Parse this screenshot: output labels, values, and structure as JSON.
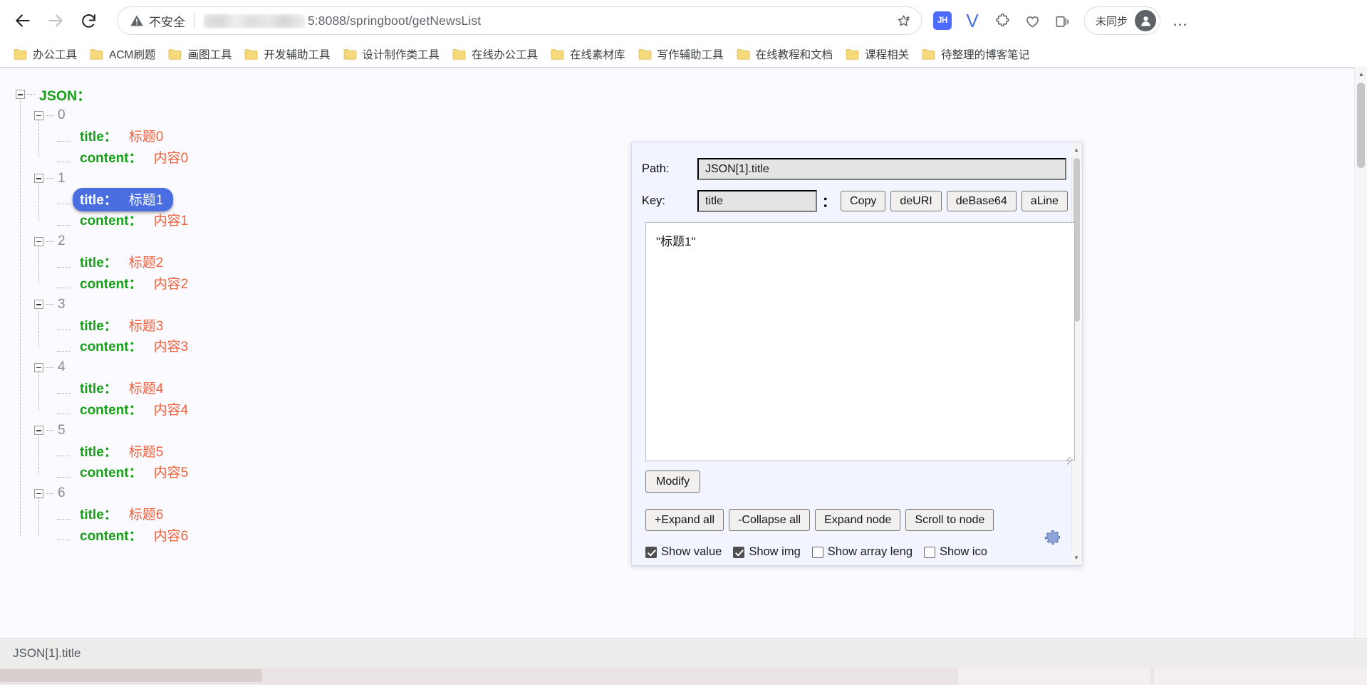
{
  "browser": {
    "nav": {
      "back": "back-arrow",
      "forward": "forward-arrow",
      "reload": "reload"
    },
    "omnibox": {
      "security_label": "不安全",
      "url_visible": "5:8088/springboot/getNewsList",
      "bookmark_icon": "star-plus-icon"
    },
    "extensions": [
      {
        "name": "jh-extension",
        "label": "JH"
      },
      {
        "name": "v-extension",
        "label": "V"
      }
    ],
    "profile": {
      "label": "未同步",
      "avatar": "person-icon"
    },
    "menu_label": "…",
    "bookmarks": [
      "办公工具",
      "ACM刷题",
      "画图工具",
      "开发辅助工具",
      "设计制作类工具",
      "在线办公工具",
      "在线素材库",
      "写作辅助工具",
      "在线教程和文档",
      "课程相关",
      "待整理的博客笔记"
    ]
  },
  "tree": {
    "root_label": "JSON：",
    "key_title": "title：",
    "key_content": "content：",
    "selected_index": 1,
    "selected_key": "title",
    "items": [
      {
        "index": "0",
        "title": "标题0",
        "content": "内容0"
      },
      {
        "index": "1",
        "title": "标题1",
        "content": "内容1"
      },
      {
        "index": "2",
        "title": "标题2",
        "content": "内容2"
      },
      {
        "index": "3",
        "title": "标题3",
        "content": "内容3"
      },
      {
        "index": "4",
        "title": "标题4",
        "content": "内容4"
      },
      {
        "index": "5",
        "title": "标题5",
        "content": "内容5"
      },
      {
        "index": "6",
        "title": "标题6",
        "content": "内容6"
      }
    ]
  },
  "panel": {
    "path_label": "Path:",
    "path_value": "JSON[1].title",
    "key_label": "Key:",
    "key_value": "title",
    "separator": "：",
    "key_buttons": [
      "Copy",
      "deURI",
      "deBase64",
      "aLine"
    ],
    "value_text": "\"标题1\"",
    "modify_label": "Modify",
    "node_buttons": [
      "+Expand all",
      "-Collapse all",
      "Expand node",
      "Scroll to node"
    ],
    "checkboxes": [
      {
        "label": "Show value",
        "checked": true
      },
      {
        "label": "Show img",
        "checked": true
      },
      {
        "label": "Show array leng",
        "checked": false
      },
      {
        "label": "Show ico",
        "checked": false
      }
    ],
    "settings_icon": "gear-icon"
  },
  "status": {
    "text": "JSON[1].title"
  }
}
